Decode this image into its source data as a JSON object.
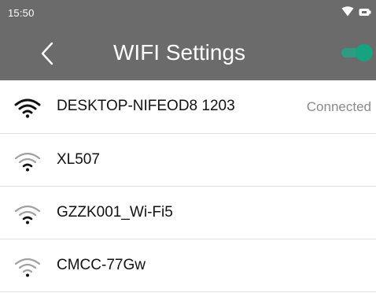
{
  "status_bar": {
    "time": "15:50",
    "icons": [
      "wifi-icon",
      "battery-icon"
    ]
  },
  "app_bar": {
    "back_icon": "chevron-left-icon",
    "title": "WIFI Settings",
    "wifi_toggle": {
      "on": true,
      "color": "#16a37f"
    }
  },
  "colors": {
    "bar_background": "#6b6b6b",
    "accent": "#16a37f",
    "strong_signal": "#111111",
    "weak_signal": "#9a9a9a"
  },
  "networks": [
    {
      "name": "DESKTOP-NIFEOD8 1203",
      "status": "Connected",
      "icon": "wifi-strong-icon"
    },
    {
      "name": "XL507",
      "status": "",
      "icon": "wifi-weak-icon"
    },
    {
      "name": "GZZK001_Wi-Fi5",
      "status": "",
      "icon": "wifi-weak-icon"
    },
    {
      "name": "CMCC-77Gw",
      "status": "",
      "icon": "wifi-weak-icon"
    }
  ]
}
